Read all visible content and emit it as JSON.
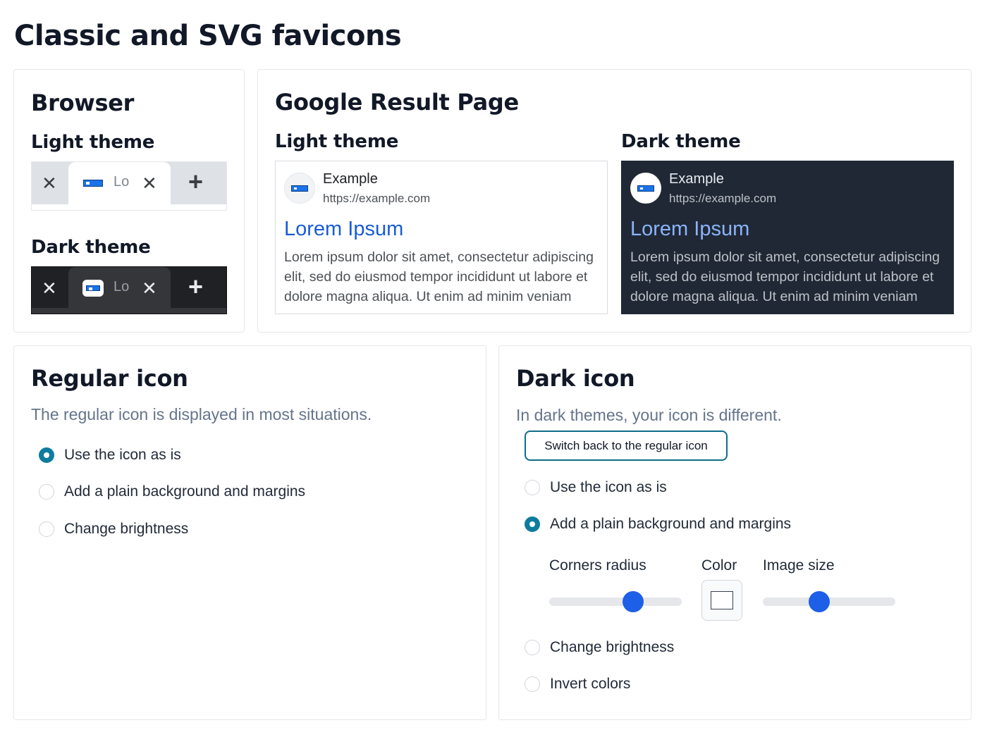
{
  "page": {
    "title": "Classic and SVG favicons"
  },
  "browser": {
    "heading": "Browser",
    "light_label": "Light theme",
    "dark_label": "Dark theme",
    "tab_label": "Lorem Ipsum",
    "close_symbol": "✕",
    "add_symbol": "+"
  },
  "google": {
    "heading": "Google Result Page",
    "light_label": "Light theme",
    "dark_label": "Dark theme",
    "result": {
      "site_name": "Example",
      "url": "https://example.com",
      "title": "Lorem Ipsum",
      "snippet": "Lorem ipsum dolor sit amet, consectetur adipiscing elit, sed do eiusmod tempor incididunt ut labore et dolore magna aliqua. Ut enim ad minim veniam"
    }
  },
  "regular": {
    "heading": "Regular icon",
    "subtitle": "The regular icon is displayed in most situations.",
    "options": [
      {
        "label": "Use the icon as is",
        "checked": true
      },
      {
        "label": "Add a plain background and margins",
        "checked": false
      },
      {
        "label": "Change brightness",
        "checked": false
      }
    ]
  },
  "dark": {
    "heading": "Dark icon",
    "subtitle": "In dark themes, your icon is different.",
    "switch_button": "Switch back to the regular icon",
    "options": [
      {
        "label": "Use the icon as is",
        "checked": false
      },
      {
        "label": "Add a plain background and margins",
        "checked": true
      },
      {
        "label": "Change brightness",
        "checked": false
      },
      {
        "label": "Invert colors",
        "checked": false
      }
    ],
    "controls": {
      "corners_radius_label": "Corners radius",
      "corners_radius_value": 0.66,
      "color_label": "Color",
      "color_value": "#ffffff",
      "image_size_label": "Image size",
      "image_size_value": 0.41
    }
  },
  "colors": {
    "accent": "#0e7c9e",
    "slider_thumb": "#1d5fe6",
    "serp_dark_bg": "#202836",
    "link": "#1a5cd8"
  }
}
